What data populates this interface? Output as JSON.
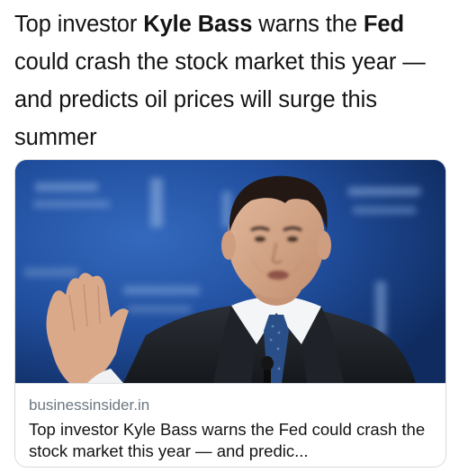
{
  "tweet": {
    "text_parts": [
      {
        "text": "Top investor ",
        "bold": false
      },
      {
        "text": "Kyle Bass",
        "bold": true
      },
      {
        "text": " warns the ",
        "bold": false
      },
      {
        "text": "Fed",
        "bold": true
      },
      {
        "text": " could crash the stock market this year — and predicts oil prices will surge this summer",
        "bold": false
      }
    ]
  },
  "card": {
    "image_label": "kyle-bass-speaking-photo",
    "domain": "businessinsider.in",
    "title": "Top investor Kyle Bass warns the Fed could crash the stock market this year — and predic..."
  },
  "colors": {
    "background": "#ffffff",
    "text": "#141414",
    "muted": "#6c7680",
    "card_border": "#d4d8dc",
    "stage_blue": "#1f4c9b"
  }
}
